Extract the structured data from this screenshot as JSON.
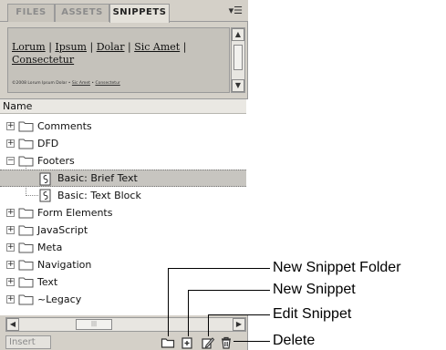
{
  "tabs": [
    {
      "label": "FILES",
      "active": false
    },
    {
      "label": "ASSETS",
      "active": false
    },
    {
      "label": "SNIPPETS",
      "active": true
    }
  ],
  "preview": {
    "links": [
      "Lorum",
      "Ipsum",
      "Dolar",
      "Sic Amet",
      "Consectetur"
    ],
    "separator": "|",
    "footer_text": "©2008 Lorum Ipsum Dolar",
    "footer_link1": "Sic Amet",
    "footer_link2": "Consectetur"
  },
  "tree": {
    "column_header": "Name",
    "items": [
      {
        "label": "Comments",
        "type": "folder",
        "expanded": false
      },
      {
        "label": "DFD",
        "type": "folder",
        "expanded": false
      },
      {
        "label": "Footers",
        "type": "folder",
        "expanded": true
      },
      {
        "label": "Basic: Brief Text",
        "type": "snippet",
        "selected": true
      },
      {
        "label": "Basic: Text Block",
        "type": "snippet",
        "selected": false
      },
      {
        "label": "Form Elements",
        "type": "folder",
        "expanded": false
      },
      {
        "label": "JavaScript",
        "type": "folder",
        "expanded": false
      },
      {
        "label": "Meta",
        "type": "folder",
        "expanded": false
      },
      {
        "label": "Navigation",
        "type": "folder",
        "expanded": false
      },
      {
        "label": "Text",
        "type": "folder",
        "expanded": false
      },
      {
        "label": "~Legacy",
        "type": "folder",
        "expanded": false
      }
    ]
  },
  "toolbar": {
    "insert_label": "Insert"
  },
  "callouts": {
    "new_folder": "New Snippet Folder",
    "new_snippet": "New Snippet",
    "edit_snippet": "Edit Snippet",
    "delete": "Delete"
  },
  "icons": {
    "folder": "folder-icon",
    "snippet": "snippet-icon",
    "new_folder": "new-folder-icon",
    "new_snippet": "new-snippet-icon",
    "edit": "edit-icon",
    "delete": "trash-icon"
  }
}
